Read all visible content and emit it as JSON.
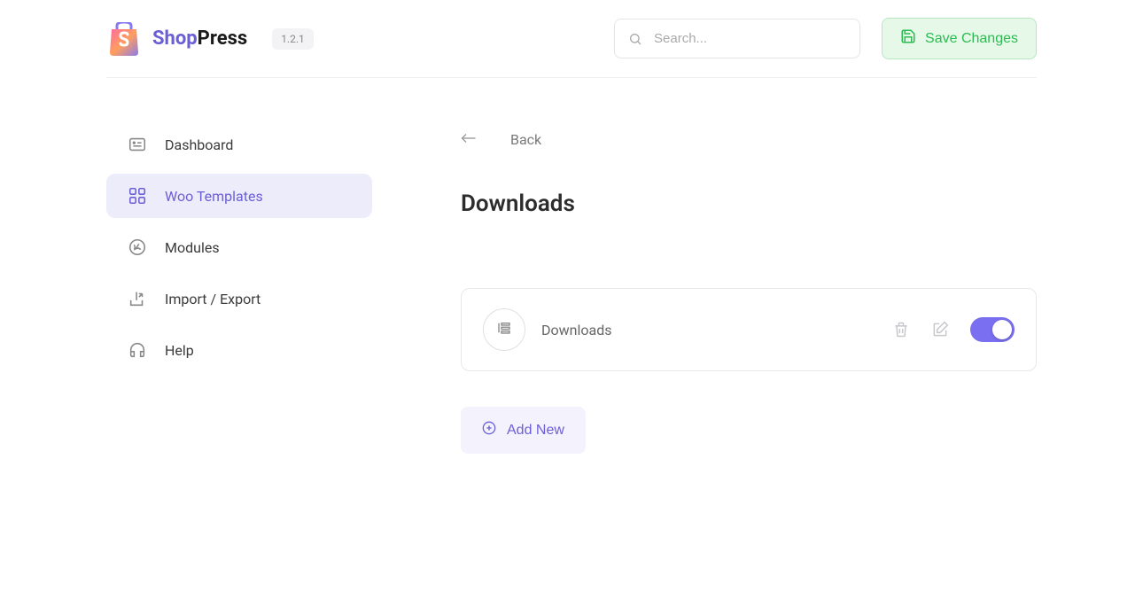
{
  "header": {
    "brand_shop": "Shop",
    "brand_press": "Press",
    "version": "1.2.1",
    "search_placeholder": "Search...",
    "save_label": "Save Changes"
  },
  "sidebar": {
    "items": [
      {
        "label": "Dashboard",
        "active": false
      },
      {
        "label": "Woo Templates",
        "active": true
      },
      {
        "label": "Modules",
        "active": false
      },
      {
        "label": "Import / Export",
        "active": false
      },
      {
        "label": "Help",
        "active": false
      }
    ]
  },
  "main": {
    "back_label": "Back",
    "heading": "Downloads",
    "template": {
      "name": "Downloads",
      "enabled": true
    },
    "add_new_label": "Add New"
  }
}
